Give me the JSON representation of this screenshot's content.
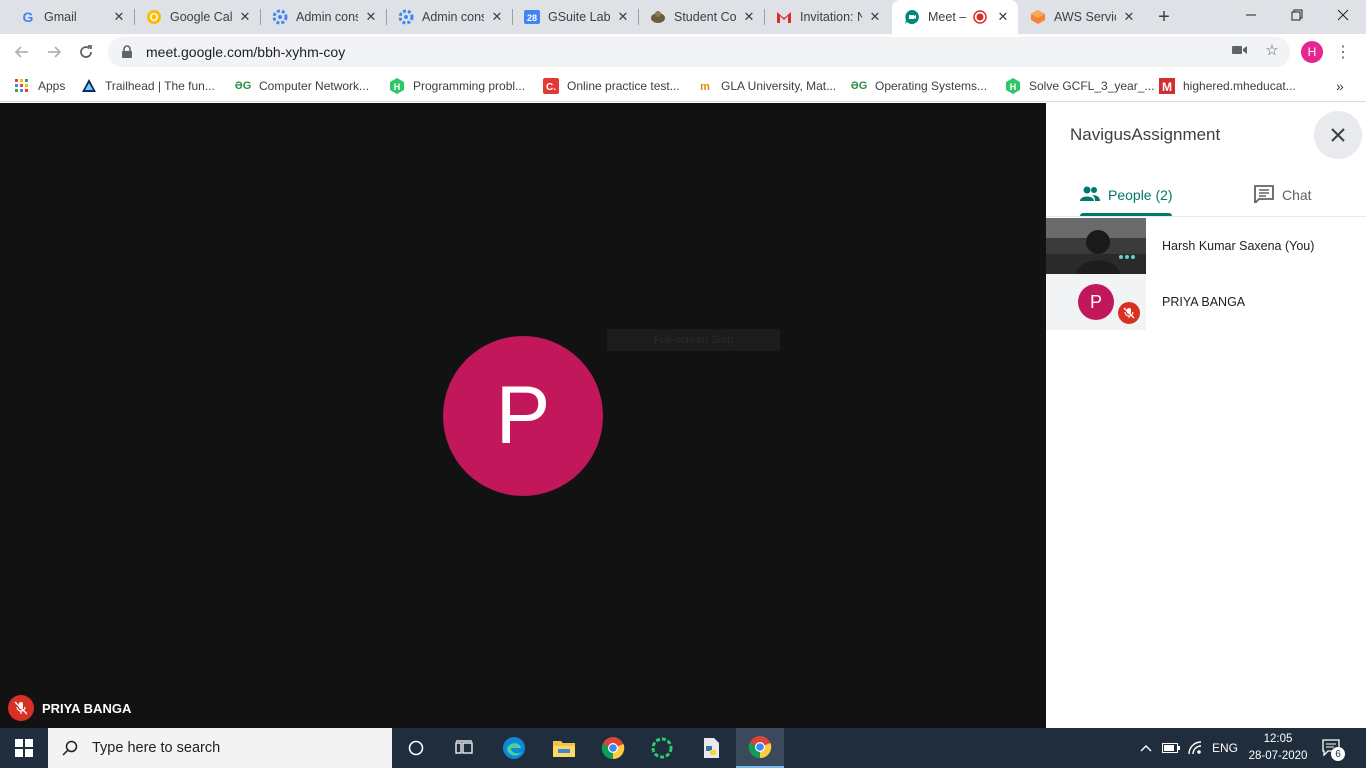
{
  "browser": {
    "tabs": [
      {
        "title": "Gmail",
        "icon": "gmail-icon"
      },
      {
        "title": "Google Cale",
        "icon": "google-calendar-icon"
      },
      {
        "title": "Admin cons",
        "icon": "admin-console-icon"
      },
      {
        "title": "Admin cons",
        "icon": "admin-console-icon"
      },
      {
        "title": "GSuite Labs",
        "icon": "calendar-28-icon"
      },
      {
        "title": "Student Cor",
        "icon": "student-corner-icon"
      },
      {
        "title": "Invitation: N",
        "icon": "gmail-m-icon"
      },
      {
        "title": "Meet –",
        "icon": "meet-icon",
        "recording": true
      },
      {
        "title": "AWS Servic",
        "icon": "aws-icon"
      }
    ],
    "url": "meet.google.com/bbh-xyhm-coy",
    "profile_initial": "H",
    "bookmarks": [
      {
        "label": "Apps",
        "icon": "apps-grid-icon"
      },
      {
        "label": "Trailhead | The fun...",
        "icon": "trailhead-icon"
      },
      {
        "label": "Computer Network...",
        "icon": "geeksforgeeks-icon"
      },
      {
        "label": "Programming probl...",
        "icon": "hackerrank-icon"
      },
      {
        "label": "Online practice test...",
        "icon": "c-icon"
      },
      {
        "label": "GLA University, Mat...",
        "icon": "gla-icon"
      },
      {
        "label": "Operating Systems...",
        "icon": "geeksforgeeks-icon"
      },
      {
        "label": "Solve GCFL_3_year_...",
        "icon": "hackerrank-icon"
      },
      {
        "label": "highered.mheducat...",
        "icon": "mheducation-icon"
      }
    ],
    "bookmarks_more": "»"
  },
  "meet": {
    "main_tile": {
      "initial": "P",
      "name": "PRIYA BANGA",
      "muted": true
    },
    "snip_overlay": "Full-screen Snip",
    "panel": {
      "title": "NavigusAssignment",
      "tabs": [
        {
          "label": "People (2)",
          "active": true
        },
        {
          "label": "Chat",
          "active": false
        }
      ],
      "people": [
        {
          "name": "Harsh Kumar Saxena (You)",
          "has_video": true
        },
        {
          "name": "PRIYA BANGA",
          "initial": "P",
          "muted": true
        }
      ]
    }
  },
  "taskbar": {
    "search_placeholder": "Type here to search",
    "language": "ENG",
    "time": "12:05",
    "date": "28-07-2020",
    "notification_count": "6"
  },
  "colors": {
    "stage_bg": "#121212",
    "avatar_bg": "#c2185b",
    "accent_teal": "#00796b",
    "mic_off_red": "#d93025"
  }
}
